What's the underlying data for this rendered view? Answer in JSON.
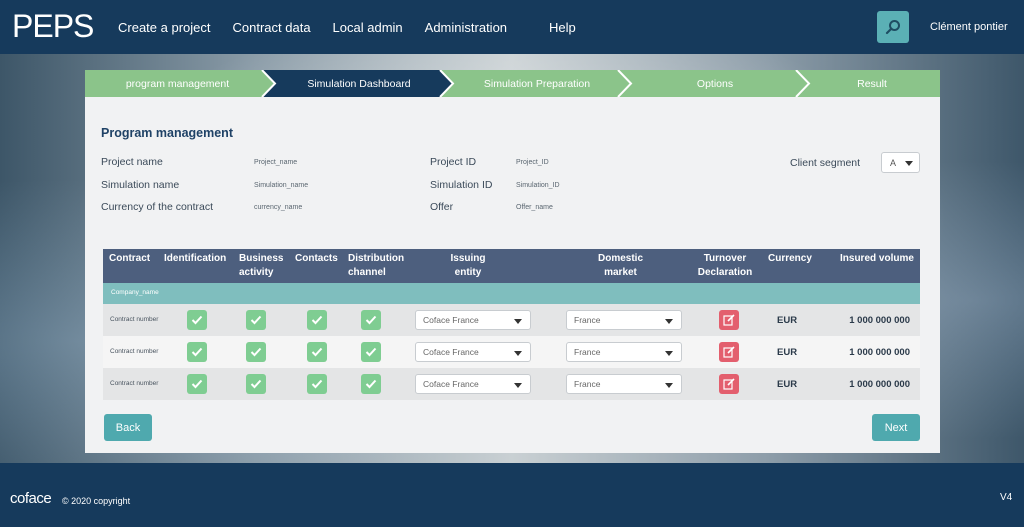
{
  "header": {
    "logo": "PEPS",
    "nav": [
      "Create a project",
      "Contract data",
      "Local admin",
      "Administration",
      "Help"
    ],
    "user": "Clément pontier"
  },
  "steps": [
    "program management",
    "Simulation Dashboard",
    "Simulation Preparation",
    "Options",
    "Result"
  ],
  "active_step": "Simulation Dashboard",
  "program": {
    "title": "Program management",
    "project_name_label": "Project name",
    "project_name_value": "Project_name",
    "simulation_name_label": "Simulation name",
    "simulation_name_value": "Simulation_name",
    "currency_label": "Currency of the contract",
    "currency_value": "currency_name",
    "project_id_label": "Project ID",
    "project_id_value": "Project_ID",
    "simulation_id_label": "Simulation ID",
    "simulation_id_value": "Simulation_ID",
    "offer_label": "Offer",
    "offer_value": "Offer_name",
    "client_segment_label": "Client segment",
    "client_segment_value": "A"
  },
  "table": {
    "headers": [
      "Contract",
      "Identification",
      "Business\nactivity",
      "Contacts",
      "Distribution\nchannel",
      "Issuing\nentity",
      "Domestic\nmarket",
      "Turnover\nDeclaration",
      "Currency",
      "Insured volume"
    ],
    "company": "Company_name",
    "rows": [
      {
        "contract": "Contract number",
        "issuing_entity": "Coface France",
        "domestic_market": "France",
        "currency": "EUR",
        "insured_volume": "1 000 000 000"
      },
      {
        "contract": "Contract number",
        "issuing_entity": "Coface France",
        "domestic_market": "France",
        "currency": "EUR",
        "insured_volume": "1 000 000 000"
      },
      {
        "contract": "Contract number",
        "issuing_entity": "Coface France",
        "domestic_market": "France",
        "currency": "EUR",
        "insured_volume": "1 000 000 000"
      }
    ]
  },
  "buttons": {
    "back": "Back",
    "next": "Next"
  },
  "footer": {
    "brand": "coface",
    "copyright": "© 2020 copyright",
    "version": "V4"
  },
  "colors": {
    "header": "#163a5c",
    "step_green": "#8bc48a",
    "step_active": "#163a5c",
    "accent": "#4fa9ae",
    "check": "#7fcd92",
    "edit": "#e35f6e"
  }
}
